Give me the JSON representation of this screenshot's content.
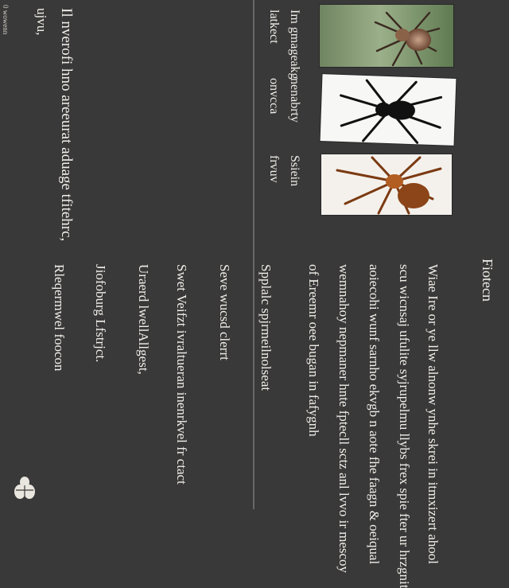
{
  "credit": {
    "small": "0 wowenn",
    "name": "ujvu,"
  },
  "intro": {
    "line1": "Il nverofi hno areeurat aduage tfitehrc,",
    "line2": "ujvu,"
  },
  "photo_labels": [
    {
      "a": "Im gmageakg",
      "b": "latkect"
    },
    {
      "a": "nenabrty",
      "b": "onvcca"
    },
    {
      "a": "Ssiein",
      "b": "frvuv"
    }
  ],
  "section": {
    "title": "Fiotecn",
    "paragraphs": [
      "Wiae Ire or ye llw alnonw ynhe skrei in itmxizert ahool",
      "scu wicnsaj ufulite syjrupelmu llybs frex spie fter ur hrzgnit",
      "aoiecohi wunf sarnho ekvgb n aote fhe faagn & oeiqual",
      "wemnahoy nepmaner hnte fptecll sctz anl lvvo ir mescoy",
      "of Ereemr oee bugan in fafygnh",
      "Spplalc spjrmeilnolseat",
      "Seve wucsd clerrt",
      "Swet Veifzt ivraltueran inenrkvel fr ctact",
      "Uraerd lwellAllgest,",
      "Jiofoburg Lfstrjct.",
      "Rleqermwel foocon"
    ]
  },
  "icons": {
    "photo1": "spider-photo-icon",
    "photo2": "spider-silhouette-icon",
    "photo3": "spider-orange-icon",
    "logo": "bug-logo-icon"
  }
}
